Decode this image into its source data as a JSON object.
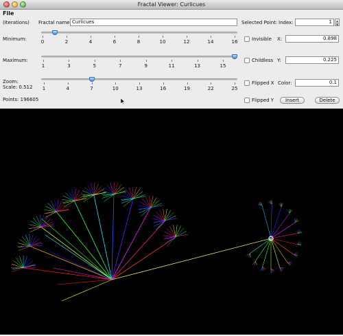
{
  "window": {
    "title": "Fractal Viewer: Curlicues"
  },
  "menu": {
    "file": "File"
  },
  "controls": {
    "iterations_label": "(Iterations)",
    "fractal_name_label": "Fractal name:",
    "fractal_name_value": "Curlicues",
    "minimum_label": "Minimum:",
    "minimum_value": 1,
    "minimum_ticks": [
      "0",
      "2",
      "4",
      "6",
      "8",
      "10",
      "12",
      "14",
      "16"
    ],
    "maximum_label": "Maximum:",
    "maximum_value": 16,
    "maximum_ticks": [
      "1",
      "3",
      "5",
      "7",
      "9",
      "11",
      "13",
      "15"
    ],
    "zoom_label": "Zoom:",
    "scale_label": "Scale: 0.512",
    "zoom_value": 7,
    "zoom_ticks": [
      "1",
      "4",
      "7",
      "10",
      "13",
      "16",
      "19",
      "22",
      "25"
    ],
    "points_label": "Points: 196605"
  },
  "selection": {
    "selected_point_label": "Selected Point:",
    "index_label": "Index:",
    "index_value": "1",
    "invisible_label": "Invisible",
    "x_label": "X:",
    "x_value": "0.898",
    "childless_label": "Childless",
    "y_label": "Y:",
    "y_value": "0.225",
    "flipped_x_label": "Flipped X",
    "color_label": "Color:",
    "color_value": "0.1",
    "flipped_y_label": "Flipped Y",
    "insert_label": "Insert",
    "delete_label": "Delete"
  },
  "colors": {
    "canvas_bg": "#000000",
    "thumb": "#3d8fe6"
  }
}
